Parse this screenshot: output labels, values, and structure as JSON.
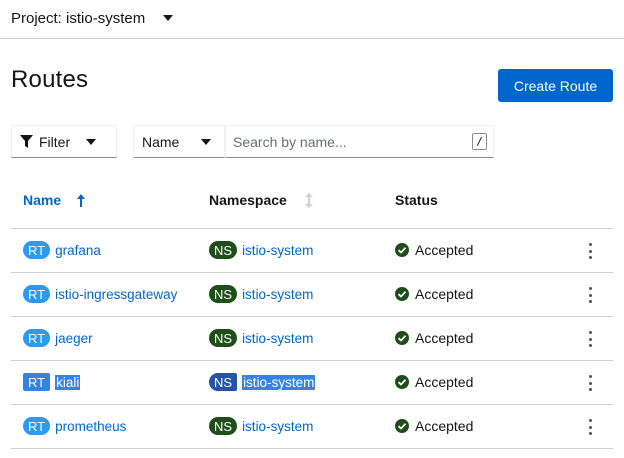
{
  "project": {
    "label": "Project: istio-system"
  },
  "page": {
    "title": "Routes",
    "create_button": "Create Route"
  },
  "toolbar": {
    "filter_label": "Filter",
    "name_select": "Name",
    "search_placeholder": "Search by name...",
    "search_value": "",
    "kbd_hint": "/"
  },
  "table": {
    "columns": [
      "Name",
      "Namespace",
      "Status"
    ],
    "sort_column": "Name",
    "sort_direction": "ascending",
    "rows": [
      {
        "badge": "RT",
        "name": "grafana",
        "ns_badge": "NS",
        "namespace": "istio-system",
        "status": "Accepted"
      },
      {
        "badge": "RT",
        "name": "istio-ingressgateway",
        "ns_badge": "NS",
        "namespace": "istio-system",
        "status": "Accepted"
      },
      {
        "badge": "RT",
        "name": "jaeger",
        "ns_badge": "NS",
        "namespace": "istio-system",
        "status": "Accepted"
      },
      {
        "badge": "RT",
        "name": "kiali",
        "ns_badge": "NS",
        "namespace": "istio-system",
        "status": "Accepted",
        "text_selected": true
      },
      {
        "badge": "RT",
        "name": "prometheus",
        "ns_badge": "NS",
        "namespace": "istio-system",
        "status": "Accepted"
      }
    ]
  },
  "colors": {
    "primary": "#0066cc",
    "rt_badge": "#2b9af3",
    "ns_badge": "#1e4f18",
    "status_ok": "#1e4f18",
    "selection": "#3584e4"
  }
}
